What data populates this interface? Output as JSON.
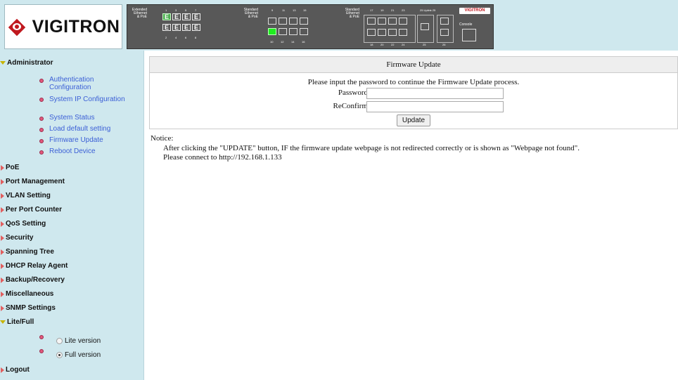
{
  "header": {
    "logo_text": "VIGITRON",
    "panel": {
      "group1_label": [
        "Extended",
        "Ethernet",
        "& PoE"
      ],
      "group2_label": [
        "Standard",
        "Ethernet",
        "& PoE"
      ],
      "group3_label": [
        "Standard",
        "Ethernet",
        "& PoE"
      ],
      "top_numbers_g1": [
        "1",
        "3",
        "5",
        "7"
      ],
      "bottom_numbers_g1": [
        "2",
        "4",
        "6",
        "8"
      ],
      "top_numbers_g2": [
        "9",
        "11",
        "13",
        "15"
      ],
      "bottom_numbers_g2": [
        "10",
        "12",
        "14",
        "16"
      ],
      "top_numbers_g3": [
        "17",
        "19",
        "21",
        "23"
      ],
      "bottom_numbers_g3": [
        "18",
        "20",
        "22",
        "24"
      ],
      "uplink_label": "25 Uplink 25",
      "port_26_label": "26",
      "port_25_label": "25",
      "port_e": "E",
      "mini_logo": "VIGITRON",
      "console_label": "Console"
    }
  },
  "sidebar": {
    "administrator": "Administrator",
    "admin_items": [
      "Authentication Configuration",
      "System IP Configuration",
      "System Status",
      "Load default setting",
      "Firmware Update",
      "Reboot Device"
    ],
    "menu": [
      "PoE",
      "Port Management",
      "VLAN Setting",
      "Per Port Counter",
      "QoS Setting",
      "Security",
      "Spanning Tree",
      "DHCP Relay Agent",
      "Backup/Recovery",
      "Miscellaneous",
      "SNMP Settings"
    ],
    "lite_full": "Lite/Full",
    "lite_version": "Lite version",
    "full_version": "Full version",
    "logout": "Logout"
  },
  "main": {
    "title": "Firmware Update",
    "instruction": "Please input the password to continue the Firmware Update process.",
    "password_label": "Password",
    "reconfirm_label": "ReConfirm",
    "password_value": "",
    "reconfirm_value": "",
    "update_button": "Update",
    "notice_title": "Notice:",
    "notice_line1": "After clicking the \"UPDATE\" button, IF the firmware update webpage is not redirected correctly or is shown as \"Webpage not found\".",
    "notice_line2": "Please connect to http://192.168.1.133"
  },
  "colors": {
    "sidebar_bg": "#cfe8ee",
    "link": "#3b5fd6",
    "brand_red": "#c0191f",
    "port_lit": "#1eee1e"
  }
}
